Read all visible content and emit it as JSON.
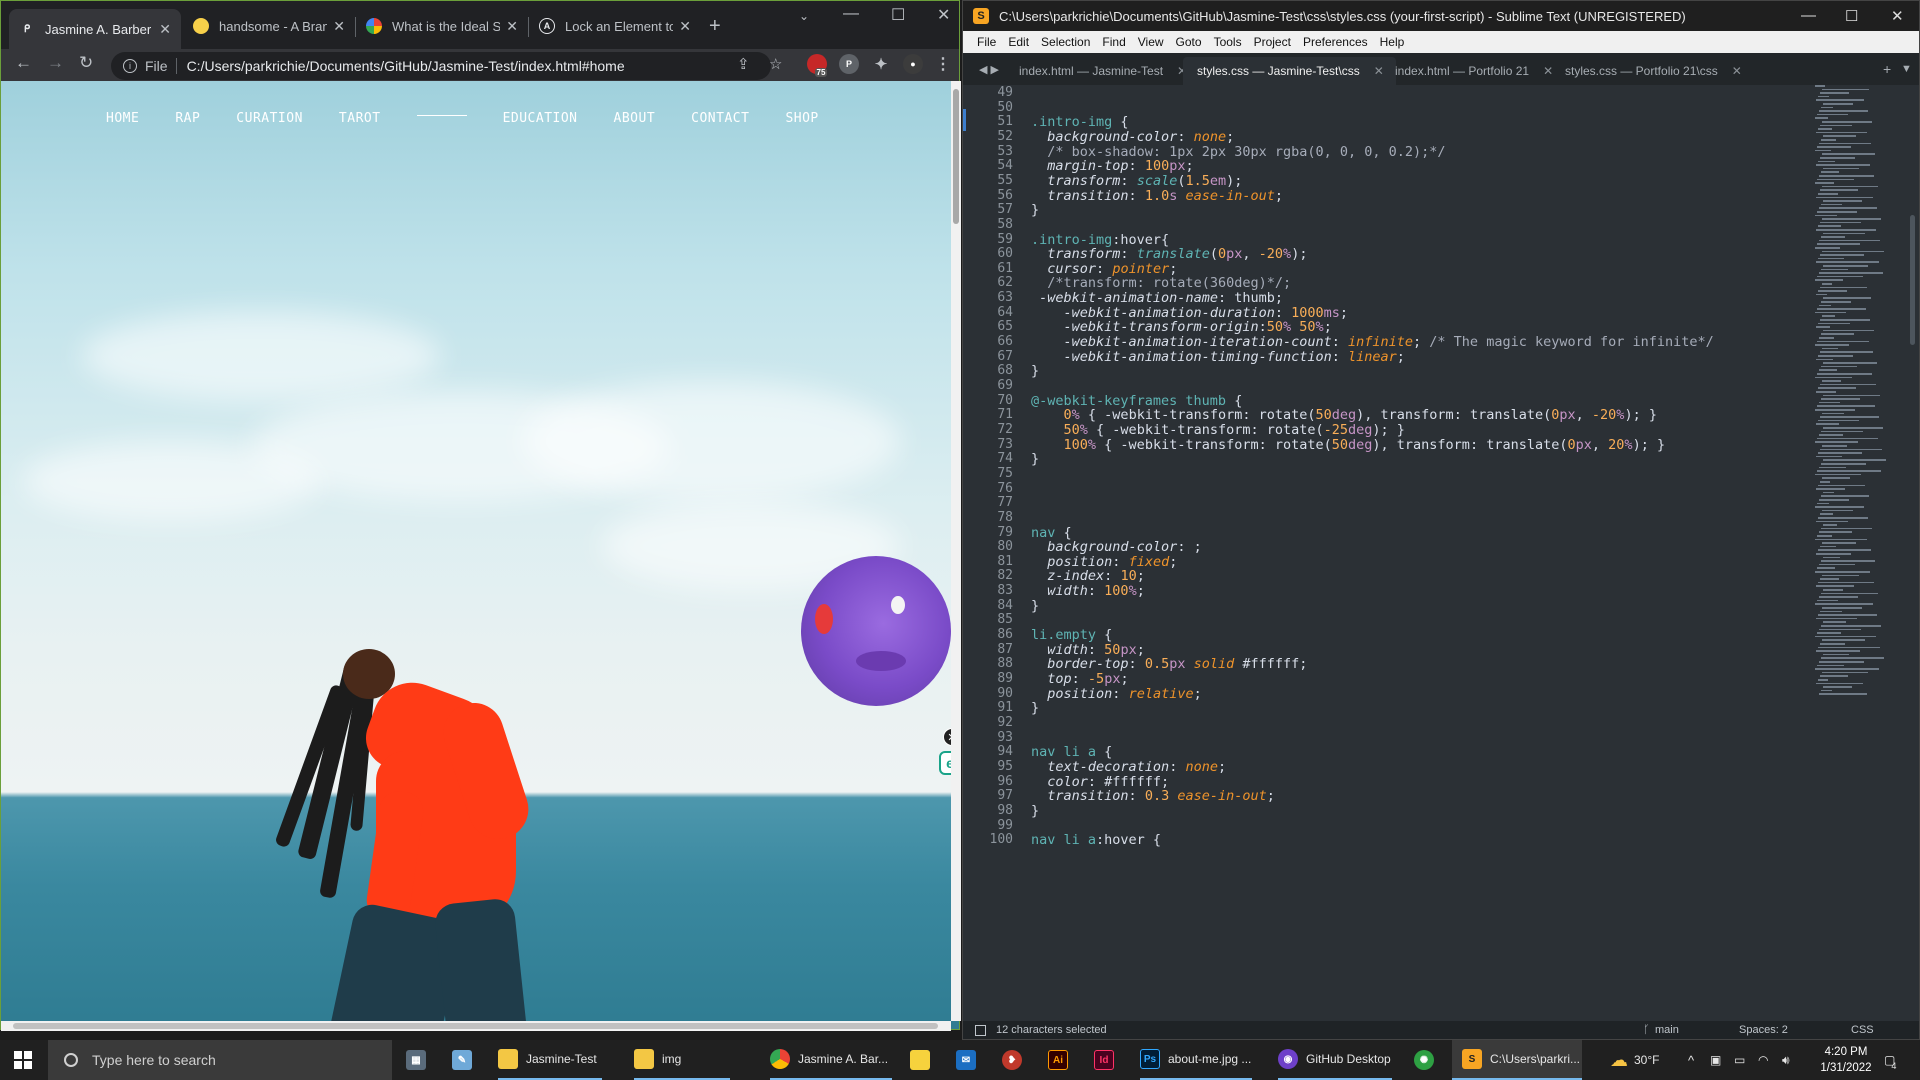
{
  "chrome": {
    "tabs": [
      {
        "title": "Jasmine A. Barber",
        "icon": "page-icon",
        "active": true
      },
      {
        "title": "handsome - A Brand",
        "icon": "yellow-circle-icon",
        "active": false
      },
      {
        "title": "What is the Ideal Sc",
        "icon": "google-icon",
        "active": false
      },
      {
        "title": "Lock an Element to",
        "icon": "a-logo-icon",
        "active": false
      }
    ],
    "new_tab": "+",
    "address": {
      "file_label": "File",
      "url": "C:/Users/parkrichie/Documents/GitHub/Jasmine-Test/index.html#home"
    },
    "extension_badge": "75"
  },
  "site": {
    "nav": [
      "HOME",
      "RAP",
      "CURATION",
      "TAROT",
      "EDUCATION",
      "ABOUT",
      "CONTACT",
      "SHOP"
    ]
  },
  "sublime": {
    "title": "C:\\Users\\parkrichie\\Documents\\GitHub\\Jasmine-Test\\css\\styles.css (your-first-script) - Sublime Text (UNREGISTERED)",
    "menu": [
      "File",
      "Edit",
      "Selection",
      "Find",
      "View",
      "Goto",
      "Tools",
      "Project",
      "Preferences",
      "Help"
    ],
    "tabs": [
      {
        "title": "index.html — Jasmine-Test",
        "active": false
      },
      {
        "title": "styles.css — Jasmine-Test\\css",
        "active": true
      },
      {
        "title": "index.html — Portfolio 21",
        "active": false
      },
      {
        "title": "styles.css — Portfolio 21\\css",
        "active": false
      }
    ],
    "first_line": 49,
    "code": [
      "",
      "",
      ".intro-img {",
      "  background-color: none;",
      "  /* box-shadow: 1px 2px 30px rgba(0, 0, 0, 0.2);*/",
      "  margin-top: 100px;",
      "  transform: scale(1.5em);",
      "  transition: 1.0s ease-in-out;",
      "}",
      "",
      ".intro-img:hover{",
      "  transform: translate(0px, -20%);",
      "  cursor: pointer;",
      "  /*transform: rotate(360deg)*/;",
      " -webkit-animation-name: thumb;",
      "    -webkit-animation-duration: 1000ms;",
      "    -webkit-transform-origin:50% 50%;",
      "    -webkit-animation-iteration-count: infinite; /* The magic keyword for infinite*/",
      "    -webkit-animation-timing-function: linear;",
      "}",
      "",
      "@-webkit-keyframes thumb {",
      "    0% { -webkit-transform: rotate(50deg), transform: translate(0px, -20%); }",
      "    50% { -webkit-transform: rotate(-25deg); }",
      "    100% { -webkit-transform: rotate(50deg), transform: translate(0px, 20%); }",
      "}",
      "",
      "",
      "",
      "",
      "nav {",
      "  background-color: ;",
      "  position: fixed;",
      "  z-index: 10;",
      "  width: 100%;",
      "}",
      "",
      "li.empty {",
      "  width: 50px;",
      "  border-top: 0.5px solid #ffffff;",
      "  top: -5px;",
      "  position: relative;",
      "}",
      "",
      "",
      "nav li a {",
      "  text-decoration: none;",
      "  color: #ffffff;",
      "  transition: 0.3 ease-in-out;",
      "}",
      "",
      "nav li a:hover {"
    ],
    "status": {
      "selection": "12 characters selected",
      "branch": "main",
      "indent": "Spaces: 2",
      "syntax": "CSS"
    }
  },
  "taskbar": {
    "search_placeholder": "Type here to search",
    "items": [
      {
        "label": "",
        "icon": "calculator-icon"
      },
      {
        "label": "",
        "icon": "notepad-icon"
      },
      {
        "label": "Jasmine-Test",
        "icon": "folder-icon"
      },
      {
        "label": "img",
        "icon": "folder-icon"
      },
      {
        "label": "Jasmine A. Bar...",
        "icon": "chrome-icon"
      },
      {
        "label": "",
        "icon": "sticky-notes-icon"
      },
      {
        "label": "",
        "icon": "outlook-icon"
      },
      {
        "label": "",
        "icon": "bird-icon"
      },
      {
        "label": "",
        "icon": "illustrator-icon"
      },
      {
        "label": "",
        "icon": "indesign-icon"
      },
      {
        "label": "about-me.jpg ...",
        "icon": "photoshop-icon"
      },
      {
        "label": "GitHub Desktop",
        "icon": "github-icon"
      },
      {
        "label": "",
        "icon": "green-app-icon"
      },
      {
        "label": "C:\\Users\\parkri...",
        "icon": "sublime-icon"
      }
    ],
    "weather": "30°F",
    "time": "4:20 PM",
    "date": "1/31/2022",
    "notifications": "4"
  },
  "colors": {
    "chrome_border": "#6b9f3a",
    "editor_bg": "#2b3035",
    "selector": "#5fb4b4",
    "value": "#ee932b",
    "number": "#f9ae58",
    "hoodie": "#ff3b16"
  }
}
